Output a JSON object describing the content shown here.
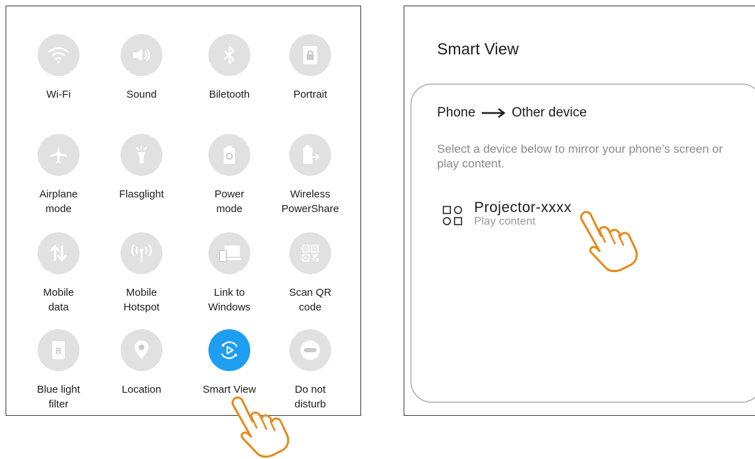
{
  "quick_settings": {
    "tiles": [
      {
        "label": "Wi-Fi",
        "icon": "wifi-icon"
      },
      {
        "label": "Sound",
        "icon": "sound-icon"
      },
      {
        "label": "Biletooth",
        "icon": "bluetooth-icon"
      },
      {
        "label": "Portrait",
        "icon": "lock-icon"
      },
      {
        "label": "Airplane\nmode",
        "icon": "airplane-icon"
      },
      {
        "label": "Flasglight",
        "icon": "flashlight-icon"
      },
      {
        "label": "Power\nmode",
        "icon": "battery-icon"
      },
      {
        "label": "Wireless\nPowerShare",
        "icon": "powershare-icon"
      },
      {
        "label": "Mobile\ndata",
        "icon": "data-arrows-icon"
      },
      {
        "label": "Mobile\nHotspot",
        "icon": "hotspot-icon"
      },
      {
        "label": "Link to\nWindows",
        "icon": "link-windows-icon"
      },
      {
        "label": "Scan QR\ncode",
        "icon": "qr-code-icon"
      },
      {
        "label": "Blue light\nfilter",
        "icon": "blue-light-icon"
      },
      {
        "label": "Location",
        "icon": "location-pin-icon"
      },
      {
        "label": "Smart View",
        "icon": "smart-view-icon",
        "active": true
      },
      {
        "label": "Do not\ndisturb",
        "icon": "do-not-disturb-icon"
      }
    ],
    "active_color": "#1e9ef0"
  },
  "smart_view": {
    "title": "Smart View",
    "direction_from": "Phone",
    "direction_to": "Other device",
    "description": "Select a device below to mirror your phone’s screen or play content.",
    "device": {
      "name": "Projector-xxxx",
      "subtitle": "Play content",
      "icon": "device-grid-icon"
    }
  },
  "accent_color": "#e88a1a"
}
